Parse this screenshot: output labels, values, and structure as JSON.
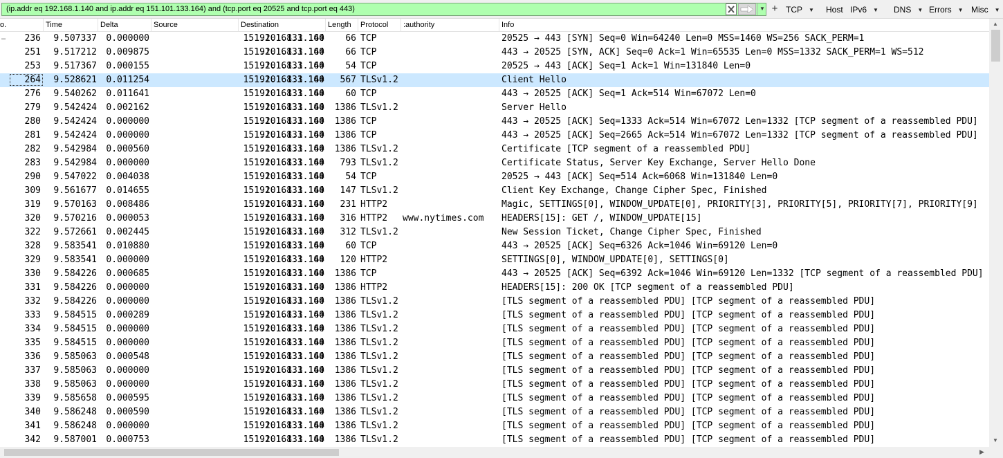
{
  "filter": {
    "expression": "(ip.addr eq 192.168.1.140 and ip.addr eq 151.101.133.164) and (tcp.port eq 20525 and tcp.port eq 443)"
  },
  "icons": {
    "clear": "clear-x-icon",
    "apply": "apply-arrow-icon",
    "history": "chevron-down-icon",
    "add": "plus-icon"
  },
  "colors": {
    "filter_valid_bg": "#afffaf",
    "selected_row_bg": "#cce8ff"
  },
  "toolbar": {
    "add_label": "+",
    "buttons": [
      {
        "label": "TCP",
        "has_menu": true
      },
      {
        "label": "Host",
        "has_menu": false
      },
      {
        "label": "IPv6",
        "has_menu": true
      },
      {
        "label": "DNS",
        "has_menu": true
      },
      {
        "label": "Errors",
        "has_menu": true
      },
      {
        "label": "Misc",
        "has_menu": true
      }
    ]
  },
  "columns": {
    "no": "o.",
    "time": "Time",
    "delta": "Delta",
    "source": "Source",
    "destination": "Destination",
    "length": "Length",
    "protocol": "Protocol",
    "authority": ":authority",
    "info": "Info"
  },
  "conversation_marker": "–",
  "packets": [
    {
      "no": "236",
      "time": "9.507337",
      "delta": "0.000000",
      "src": "192.168.1.140",
      "dst": "151.101.133.164",
      "len": "66",
      "proto": "TCP",
      "auth": "",
      "info": "20525 → 443 [SYN] Seq=0 Win=64240 Len=0 MSS=1460 WS=256 SACK_PERM=1"
    },
    {
      "no": "251",
      "time": "9.517212",
      "delta": "0.009875",
      "src": "151.101.133.164",
      "dst": "192.168.1.140",
      "len": "66",
      "proto": "TCP",
      "auth": "",
      "info": "443 → 20525 [SYN, ACK] Seq=0 Ack=1 Win=65535 Len=0 MSS=1332 SACK_PERM=1 WS=512"
    },
    {
      "no": "253",
      "time": "9.517367",
      "delta": "0.000155",
      "src": "192.168.1.140",
      "dst": "151.101.133.164",
      "len": "54",
      "proto": "TCP",
      "auth": "",
      "info": "20525 → 443 [ACK] Seq=1 Ack=1 Win=131840 Len=0"
    },
    {
      "no": "264",
      "time": "9.528621",
      "delta": "0.011254",
      "src": "192.168.1.140",
      "dst": "151.101.133.164",
      "len": "567",
      "proto": "TLSv1.2",
      "auth": "",
      "info": "Client Hello",
      "selected": true
    },
    {
      "no": "276",
      "time": "9.540262",
      "delta": "0.011641",
      "src": "151.101.133.164",
      "dst": "192.168.1.140",
      "len": "60",
      "proto": "TCP",
      "auth": "",
      "info": "443 → 20525 [ACK] Seq=1 Ack=514 Win=67072 Len=0"
    },
    {
      "no": "279",
      "time": "9.542424",
      "delta": "0.002162",
      "src": "151.101.133.164",
      "dst": "192.168.1.140",
      "len": "1386",
      "proto": "TLSv1.2",
      "auth": "",
      "info": "Server Hello"
    },
    {
      "no": "280",
      "time": "9.542424",
      "delta": "0.000000",
      "src": "151.101.133.164",
      "dst": "192.168.1.140",
      "len": "1386",
      "proto": "TCP",
      "auth": "",
      "info": "443 → 20525 [ACK] Seq=1333 Ack=514 Win=67072 Len=1332 [TCP segment of a reassembled PDU]"
    },
    {
      "no": "281",
      "time": "9.542424",
      "delta": "0.000000",
      "src": "151.101.133.164",
      "dst": "192.168.1.140",
      "len": "1386",
      "proto": "TCP",
      "auth": "",
      "info": "443 → 20525 [ACK] Seq=2665 Ack=514 Win=67072 Len=1332 [TCP segment of a reassembled PDU]"
    },
    {
      "no": "282",
      "time": "9.542984",
      "delta": "0.000560",
      "src": "151.101.133.164",
      "dst": "192.168.1.140",
      "len": "1386",
      "proto": "TLSv1.2",
      "auth": "",
      "info": "Certificate [TCP segment of a reassembled PDU]"
    },
    {
      "no": "283",
      "time": "9.542984",
      "delta": "0.000000",
      "src": "151.101.133.164",
      "dst": "192.168.1.140",
      "len": "793",
      "proto": "TLSv1.2",
      "auth": "",
      "info": "Certificate Status, Server Key Exchange, Server Hello Done"
    },
    {
      "no": "290",
      "time": "9.547022",
      "delta": "0.004038",
      "src": "192.168.1.140",
      "dst": "151.101.133.164",
      "len": "54",
      "proto": "TCP",
      "auth": "",
      "info": "20525 → 443 [ACK] Seq=514 Ack=6068 Win=131840 Len=0"
    },
    {
      "no": "309",
      "time": "9.561677",
      "delta": "0.014655",
      "src": "192.168.1.140",
      "dst": "151.101.133.164",
      "len": "147",
      "proto": "TLSv1.2",
      "auth": "",
      "info": "Client Key Exchange, Change Cipher Spec, Finished"
    },
    {
      "no": "319",
      "time": "9.570163",
      "delta": "0.008486",
      "src": "192.168.1.140",
      "dst": "151.101.133.164",
      "len": "231",
      "proto": "HTTP2",
      "auth": "",
      "info": "Magic, SETTINGS[0], WINDOW_UPDATE[0], PRIORITY[3], PRIORITY[5], PRIORITY[7], PRIORITY[9]"
    },
    {
      "no": "320",
      "time": "9.570216",
      "delta": "0.000053",
      "src": "192.168.1.140",
      "dst": "151.101.133.164",
      "len": "316",
      "proto": "HTTP2",
      "auth": "www.nytimes.com",
      "info": "HEADERS[15]: GET /, WINDOW_UPDATE[15]"
    },
    {
      "no": "322",
      "time": "9.572661",
      "delta": "0.002445",
      "src": "151.101.133.164",
      "dst": "192.168.1.140",
      "len": "312",
      "proto": "TLSv1.2",
      "auth": "",
      "info": "New Session Ticket, Change Cipher Spec, Finished"
    },
    {
      "no": "328",
      "time": "9.583541",
      "delta": "0.010880",
      "src": "151.101.133.164",
      "dst": "192.168.1.140",
      "len": "60",
      "proto": "TCP",
      "auth": "",
      "info": "443 → 20525 [ACK] Seq=6326 Ack=1046 Win=69120 Len=0"
    },
    {
      "no": "329",
      "time": "9.583541",
      "delta": "0.000000",
      "src": "151.101.133.164",
      "dst": "192.168.1.140",
      "len": "120",
      "proto": "HTTP2",
      "auth": "",
      "info": "SETTINGS[0], WINDOW_UPDATE[0], SETTINGS[0]"
    },
    {
      "no": "330",
      "time": "9.584226",
      "delta": "0.000685",
      "src": "151.101.133.164",
      "dst": "192.168.1.140",
      "len": "1386",
      "proto": "TCP",
      "auth": "",
      "info": "443 → 20525 [ACK] Seq=6392 Ack=1046 Win=69120 Len=1332 [TCP segment of a reassembled PDU]"
    },
    {
      "no": "331",
      "time": "9.584226",
      "delta": "0.000000",
      "src": "151.101.133.164",
      "dst": "192.168.1.140",
      "len": "1386",
      "proto": "HTTP2",
      "auth": "",
      "info": "HEADERS[15]: 200 OK [TCP segment of a reassembled PDU]"
    },
    {
      "no": "332",
      "time": "9.584226",
      "delta": "0.000000",
      "src": "151.101.133.164",
      "dst": "192.168.1.140",
      "len": "1386",
      "proto": "TLSv1.2",
      "auth": "",
      "info": "[TLS segment of a reassembled PDU] [TCP segment of a reassembled PDU]"
    },
    {
      "no": "333",
      "time": "9.584515",
      "delta": "0.000289",
      "src": "151.101.133.164",
      "dst": "192.168.1.140",
      "len": "1386",
      "proto": "TLSv1.2",
      "auth": "",
      "info": "[TLS segment of a reassembled PDU] [TCP segment of a reassembled PDU]"
    },
    {
      "no": "334",
      "time": "9.584515",
      "delta": "0.000000",
      "src": "151.101.133.164",
      "dst": "192.168.1.140",
      "len": "1386",
      "proto": "TLSv1.2",
      "auth": "",
      "info": "[TLS segment of a reassembled PDU] [TCP segment of a reassembled PDU]"
    },
    {
      "no": "335",
      "time": "9.584515",
      "delta": "0.000000",
      "src": "151.101.133.164",
      "dst": "192.168.1.140",
      "len": "1386",
      "proto": "TLSv1.2",
      "auth": "",
      "info": "[TLS segment of a reassembled PDU] [TCP segment of a reassembled PDU]"
    },
    {
      "no": "336",
      "time": "9.585063",
      "delta": "0.000548",
      "src": "151.101.133.164",
      "dst": "192.168.1.140",
      "len": "1386",
      "proto": "TLSv1.2",
      "auth": "",
      "info": "[TLS segment of a reassembled PDU] [TCP segment of a reassembled PDU]"
    },
    {
      "no": "337",
      "time": "9.585063",
      "delta": "0.000000",
      "src": "151.101.133.164",
      "dst": "192.168.1.140",
      "len": "1386",
      "proto": "TLSv1.2",
      "auth": "",
      "info": "[TLS segment of a reassembled PDU] [TCP segment of a reassembled PDU]"
    },
    {
      "no": "338",
      "time": "9.585063",
      "delta": "0.000000",
      "src": "151.101.133.164",
      "dst": "192.168.1.140",
      "len": "1386",
      "proto": "TLSv1.2",
      "auth": "",
      "info": "[TLS segment of a reassembled PDU] [TCP segment of a reassembled PDU]"
    },
    {
      "no": "339",
      "time": "9.585658",
      "delta": "0.000595",
      "src": "151.101.133.164",
      "dst": "192.168.1.140",
      "len": "1386",
      "proto": "TLSv1.2",
      "auth": "",
      "info": "[TLS segment of a reassembled PDU] [TCP segment of a reassembled PDU]"
    },
    {
      "no": "340",
      "time": "9.586248",
      "delta": "0.000590",
      "src": "151.101.133.164",
      "dst": "192.168.1.140",
      "len": "1386",
      "proto": "TLSv1.2",
      "auth": "",
      "info": "[TLS segment of a reassembled PDU] [TCP segment of a reassembled PDU]"
    },
    {
      "no": "341",
      "time": "9.586248",
      "delta": "0.000000",
      "src": "151.101.133.164",
      "dst": "192.168.1.140",
      "len": "1386",
      "proto": "TLSv1.2",
      "auth": "",
      "info": "[TLS segment of a reassembled PDU] [TCP segment of a reassembled PDU]"
    },
    {
      "no": "342",
      "time": "9.587001",
      "delta": "0.000753",
      "src": "151.101.133.164",
      "dst": "192.168.1.140",
      "len": "1386",
      "proto": "TLSv1.2",
      "auth": "",
      "info": "[TLS segment of a reassembled PDU] [TCP segment of a reassembled PDU]"
    }
  ]
}
